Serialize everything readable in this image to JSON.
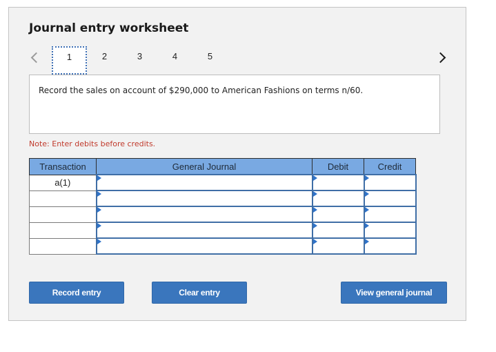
{
  "header": {
    "title": "Journal entry worksheet"
  },
  "navigation": {
    "prev_icon": "chevron-left-icon",
    "next_icon": "chevron-right-icon",
    "active_tab": "1",
    "tabs": [
      "1",
      "2",
      "3",
      "4",
      "5"
    ]
  },
  "instruction": {
    "text": "Record the sales on account of $290,000 to American Fashions on terms n/60."
  },
  "note": {
    "text": "Note: Enter debits before credits.",
    "color": "#c0392b"
  },
  "journal_table": {
    "columns": [
      "Transaction",
      "General Journal",
      "Debit",
      "Credit"
    ],
    "rows": [
      {
        "transaction": "a(1)",
        "account": "",
        "debit": "",
        "credit": ""
      },
      {
        "transaction": "",
        "account": "",
        "debit": "",
        "credit": ""
      },
      {
        "transaction": "",
        "account": "",
        "debit": "",
        "credit": ""
      },
      {
        "transaction": "",
        "account": "",
        "debit": "",
        "credit": ""
      },
      {
        "transaction": "",
        "account": "",
        "debit": "",
        "credit": ""
      }
    ],
    "header_color": "#79a9e2"
  },
  "buttons": {
    "record_entry": "Record entry",
    "clear_entry": "Clear entry",
    "view_general_journal": "View general journal",
    "color": "#3a76bd"
  }
}
